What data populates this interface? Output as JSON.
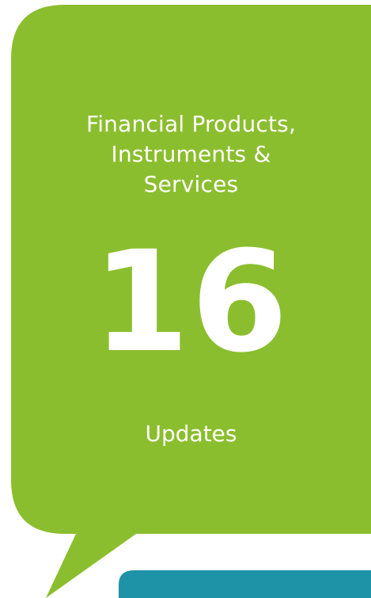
{
  "card": {
    "category_lines": [
      "Financial Products,",
      "Instruments &",
      "Services"
    ],
    "count": "16",
    "unit_label": "Updates"
  },
  "colors": {
    "bubble": "#8BBE2E",
    "accent_teal": "#1E93A8",
    "text": "#FFFFFF"
  }
}
